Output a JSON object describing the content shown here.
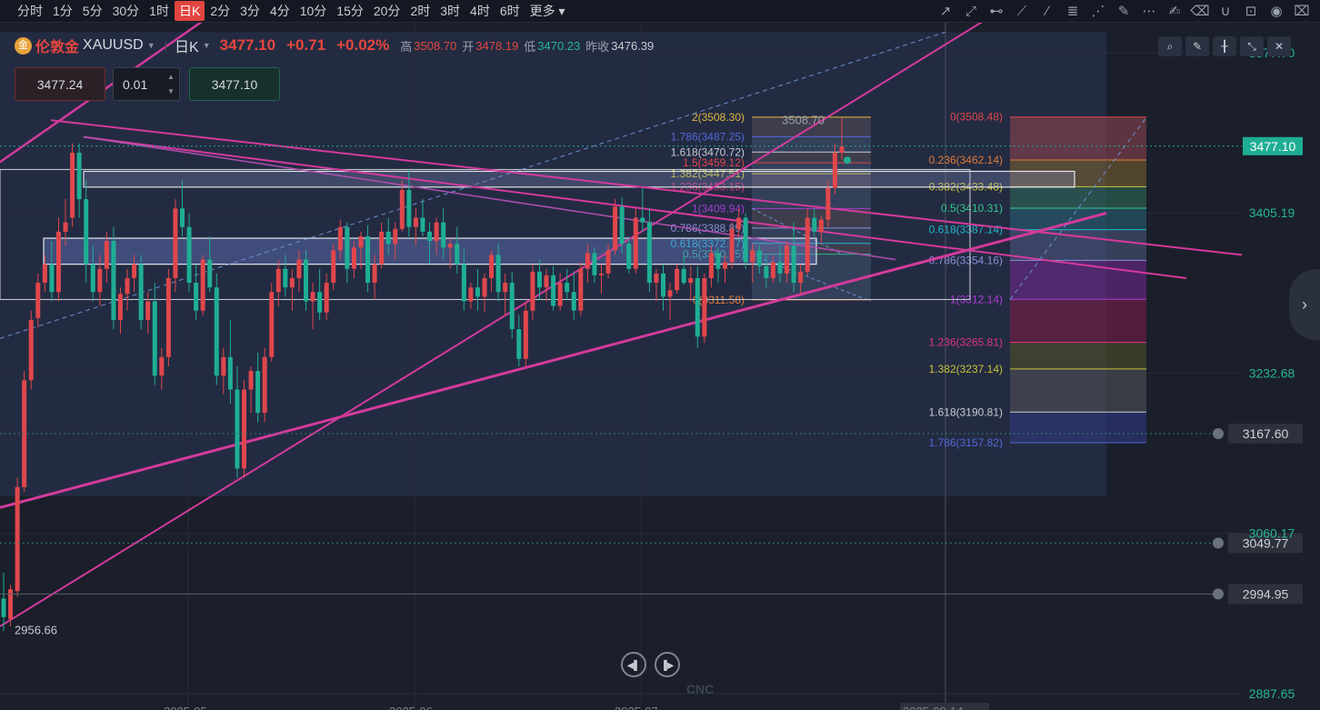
{
  "timeframes": [
    "分时",
    "1分",
    "5分",
    "30分",
    "1时",
    "日K",
    "2分",
    "3分",
    "4分",
    "10分",
    "15分",
    "20分",
    "2时",
    "3时",
    "4时",
    "6时",
    "更多"
  ],
  "active_timeframe": "日K",
  "toolbar_icons": [
    "trend-line-icon",
    "ray-icon",
    "horizontal-line-icon",
    "polyline-icon",
    "brush-icon",
    "fibonacci-icon",
    "fan-icon",
    "pen-icon",
    "more-dots-icon",
    "note-icon",
    "eraser-icon",
    "magnet-icon",
    "lock-icon",
    "eye-icon",
    "trash-icon"
  ],
  "symbol": {
    "icon_text": "金",
    "name": "伦敦金",
    "code": "XAUUSD",
    "period": "日K",
    "price": "3477.10",
    "change": "+0.71",
    "change_pct": "+0.02%",
    "high_label": "高",
    "high": "3508.70",
    "open_label": "开",
    "open": "3478.19",
    "low_label": "低",
    "low": "3470.23",
    "prev_label": "昨收",
    "prev": "3476.39"
  },
  "order": {
    "sell": "3477.24",
    "qty": "0.01",
    "buy": "3477.10"
  },
  "colors": {
    "up": "#e0474c",
    "down": "#1fae94",
    "accent": "#e0453f",
    "magenta": "#d43a9c"
  },
  "chart_data": {
    "type": "candlestick",
    "y_range": [
      2870,
      3610
    ],
    "y_ticks": [
      "3577.70",
      "3405.19",
      "3232.68",
      "3060.17",
      "2887.65"
    ],
    "current_price": "3477.10",
    "alerts": [
      "3167.60",
      "3049.77",
      "2994.95"
    ],
    "low_label": "2956.66",
    "high_label": "3508.70",
    "x_ticks": [
      "2025-05",
      "2025-06",
      "2025-07",
      "2025-08-14"
    ],
    "candles": [
      [
        2990,
        3018,
        2955,
        2970
      ],
      [
        2968,
        3005,
        2960,
        3000
      ],
      [
        2998,
        3120,
        2992,
        3110
      ],
      [
        3110,
        3235,
        3105,
        3225
      ],
      [
        3225,
        3300,
        3215,
        3290
      ],
      [
        3292,
        3340,
        3282,
        3330
      ],
      [
        3330,
        3360,
        3320,
        3350
      ],
      [
        3350,
        3375,
        3310,
        3320
      ],
      [
        3320,
        3400,
        3310,
        3385
      ],
      [
        3385,
        3420,
        3370,
        3395
      ],
      [
        3400,
        3480,
        3390,
        3470
      ],
      [
        3470,
        3480,
        3400,
        3420
      ],
      [
        3420,
        3440,
        3330,
        3350
      ],
      [
        3350,
        3370,
        3310,
        3320
      ],
      [
        3320,
        3360,
        3305,
        3345
      ],
      [
        3345,
        3385,
        3330,
        3375
      ],
      [
        3375,
        3390,
        3280,
        3290
      ],
      [
        3290,
        3325,
        3275,
        3318
      ],
      [
        3318,
        3345,
        3300,
        3335
      ],
      [
        3335,
        3360,
        3320,
        3350
      ],
      [
        3350,
        3360,
        3280,
        3290
      ],
      [
        3290,
        3320,
        3275,
        3310
      ],
      [
        3310,
        3330,
        3220,
        3230
      ],
      [
        3230,
        3260,
        3215,
        3250
      ],
      [
        3250,
        3345,
        3240,
        3335
      ],
      [
        3335,
        3420,
        3320,
        3410
      ],
      [
        3410,
        3440,
        3380,
        3390
      ],
      [
        3390,
        3405,
        3320,
        3330
      ],
      [
        3330,
        3350,
        3290,
        3300
      ],
      [
        3300,
        3360,
        3295,
        3355
      ],
      [
        3355,
        3380,
        3320,
        3325
      ],
      [
        3325,
        3340,
        3220,
        3230
      ],
      [
        3230,
        3260,
        3210,
        3250
      ],
      [
        3250,
        3290,
        3200,
        3215
      ],
      [
        3215,
        3240,
        3120,
        3130
      ],
      [
        3130,
        3225,
        3120,
        3215
      ],
      [
        3215,
        3240,
        3190,
        3235
      ],
      [
        3235,
        3255,
        3180,
        3190
      ],
      [
        3190,
        3260,
        3180,
        3250
      ],
      [
        3250,
        3330,
        3245,
        3320
      ],
      [
        3320,
        3355,
        3305,
        3345
      ],
      [
        3345,
        3360,
        3315,
        3325
      ],
      [
        3325,
        3345,
        3300,
        3335
      ],
      [
        3335,
        3365,
        3320,
        3355
      ],
      [
        3355,
        3365,
        3300,
        3310
      ],
      [
        3310,
        3330,
        3280,
        3320
      ],
      [
        3320,
        3345,
        3290,
        3298
      ],
      [
        3298,
        3340,
        3290,
        3330
      ],
      [
        3330,
        3372,
        3322,
        3365
      ],
      [
        3365,
        3398,
        3355,
        3390
      ],
      [
        3390,
        3395,
        3330,
        3345
      ],
      [
        3345,
        3375,
        3335,
        3368
      ],
      [
        3368,
        3385,
        3345,
        3380
      ],
      [
        3380,
        3392,
        3320,
        3330
      ],
      [
        3330,
        3360,
        3312,
        3350
      ],
      [
        3350,
        3395,
        3345,
        3385
      ],
      [
        3385,
        3400,
        3360,
        3372
      ],
      [
        3372,
        3395,
        3355,
        3388
      ],
      [
        3388,
        3440,
        3385,
        3430
      ],
      [
        3430,
        3452,
        3380,
        3390
      ],
      [
        3390,
        3410,
        3370,
        3400
      ],
      [
        3400,
        3420,
        3380,
        3385
      ],
      [
        3385,
        3395,
        3350,
        3375
      ],
      [
        3375,
        3400,
        3360,
        3395
      ],
      [
        3395,
        3410,
        3355,
        3368
      ],
      [
        3368,
        3378,
        3345,
        3372
      ],
      [
        3372,
        3390,
        3340,
        3350
      ],
      [
        3350,
        3366,
        3300,
        3310
      ],
      [
        3310,
        3330,
        3302,
        3325
      ],
      [
        3325,
        3345,
        3300,
        3315
      ],
      [
        3315,
        3340,
        3298,
        3335
      ],
      [
        3335,
        3365,
        3320,
        3360
      ],
      [
        3360,
        3372,
        3310,
        3320
      ],
      [
        3320,
        3340,
        3295,
        3330
      ],
      [
        3330,
        3342,
        3270,
        3280
      ],
      [
        3280,
        3295,
        3240,
        3248
      ],
      [
        3248,
        3310,
        3240,
        3300
      ],
      [
        3300,
        3350,
        3290,
        3342
      ],
      [
        3342,
        3355,
        3312,
        3325
      ],
      [
        3325,
        3345,
        3310,
        3338
      ],
      [
        3338,
        3348,
        3300,
        3305
      ],
      [
        3305,
        3340,
        3300,
        3330
      ],
      [
        3330,
        3345,
        3312,
        3320
      ],
      [
        3320,
        3342,
        3290,
        3300
      ],
      [
        3300,
        3352,
        3295,
        3345
      ],
      [
        3345,
        3372,
        3330,
        3362
      ],
      [
        3362,
        3368,
        3330,
        3338
      ],
      [
        3338,
        3350,
        3318,
        3340
      ],
      [
        3340,
        3372,
        3335,
        3365
      ],
      [
        3365,
        3420,
        3360,
        3412
      ],
      [
        3412,
        3422,
        3362,
        3372
      ],
      [
        3372,
        3380,
        3340,
        3345
      ],
      [
        3345,
        3410,
        3340,
        3400
      ],
      [
        3400,
        3432,
        3385,
        3395
      ],
      [
        3395,
        3410,
        3320,
        3330
      ],
      [
        3330,
        3345,
        3310,
        3340
      ],
      [
        3340,
        3350,
        3300,
        3315
      ],
      [
        3315,
        3330,
        3290,
        3322
      ],
      [
        3322,
        3350,
        3318,
        3345
      ],
      [
        3345,
        3360,
        3328,
        3330
      ],
      [
        3330,
        3348,
        3310,
        3335
      ],
      [
        3335,
        3348,
        3260,
        3272
      ],
      [
        3272,
        3340,
        3265,
        3335
      ],
      [
        3335,
        3370,
        3325,
        3362
      ],
      [
        3362,
        3368,
        3330,
        3345
      ],
      [
        3345,
        3360,
        3330,
        3352
      ],
      [
        3352,
        3395,
        3345,
        3388
      ],
      [
        3388,
        3410,
        3380,
        3400
      ],
      [
        3400,
        3405,
        3345,
        3352
      ],
      [
        3352,
        3372,
        3330,
        3365
      ],
      [
        3365,
        3370,
        3340,
        3348
      ],
      [
        3348,
        3360,
        3325,
        3335
      ],
      [
        3335,
        3360,
        3330,
        3352
      ],
      [
        3352,
        3370,
        3330,
        3340
      ],
      [
        3340,
        3375,
        3330,
        3370
      ],
      [
        3370,
        3395,
        3320,
        3330
      ],
      [
        3330,
        3350,
        3318,
        3342
      ],
      [
        3342,
        3410,
        3338,
        3400
      ],
      [
        3400,
        3410,
        3380,
        3385
      ],
      [
        3385,
        3402,
        3372,
        3398
      ],
      [
        3398,
        3440,
        3390,
        3432
      ],
      [
        3432,
        3480,
        3425,
        3470
      ],
      [
        3470,
        3508,
        3462,
        3477
      ]
    ]
  },
  "fib_left": {
    "levels": [
      {
        "label": "2(3508.30)",
        "price": 3508.3,
        "color": "#e2b93b"
      },
      {
        "label": "1.786(3487.25)",
        "price": 3487.25,
        "color": "#5467d8"
      },
      {
        "label": "1.618(3470.72)",
        "price": 3470.72,
        "color": "#c8cbd2"
      },
      {
        "label": "1.5(3459.12)",
        "price": 3459.12,
        "color": "#e0474c"
      },
      {
        "label": "1.382(3447.51)",
        "price": 3447.51,
        "color": "#c6c23a"
      },
      {
        "label": "1.236(3433.15)",
        "price": 3433.15,
        "color": "#c7357e"
      },
      {
        "label": "1(3409.94)",
        "price": 3409.94,
        "color": "#9f3fd2"
      },
      {
        "label": "0.786(3388.89)",
        "price": 3388.89,
        "color": "#8a8fd6"
      },
      {
        "label": "0.618(3372.37)",
        "price": 3372.37,
        "color": "#1fb8c9"
      },
      {
        "label": "0.5(3360.75)",
        "price": 3360.75,
        "color": "#2fae8d"
      },
      {
        "label": "0(3311.58)",
        "price": 3311.58,
        "color": "#e07b39"
      }
    ],
    "high_text": "3508.70"
  },
  "fib_right": {
    "levels": [
      {
        "label": "0(3508.48)",
        "price": 3508.48,
        "color": "#e0474c",
        "fill": "rgba(150,70,80,0.55)"
      },
      {
        "label": "0.236(3462.14)",
        "price": 3462.14,
        "color": "#e07b39",
        "fill": "rgba(130,100,50,0.55)"
      },
      {
        "label": "0.382(3433.48)",
        "price": 3433.48,
        "color": "#c6c23a",
        "fill": "rgba(50,110,90,0.55)"
      },
      {
        "label": "0.5(3410.31)",
        "price": 3410.31,
        "color": "#2fc98d",
        "fill": "rgba(40,100,120,0.55)"
      },
      {
        "label": "0.618(3387.14)",
        "price": 3387.14,
        "color": "#1fb8c9",
        "fill": "rgba(80,90,130,0.55)"
      },
      {
        "label": "0.786(3354.16)",
        "price": 3354.16,
        "color": "#8a8fd6",
        "fill": "rgba(110,40,140,0.6)"
      },
      {
        "label": "1(3312.14)",
        "price": 3312.14,
        "color": "#b03bd8",
        "fill": "rgba(120,30,70,0.6)"
      },
      {
        "label": "1.236(3265.81)",
        "price": 3265.81,
        "color": "#e0357e",
        "fill": "rgba(80,80,40,0.6)"
      },
      {
        "label": "1.382(3237.14)",
        "price": 3237.14,
        "color": "#c6c23a",
        "fill": "rgba(80,80,85,0.6)"
      },
      {
        "label": "1.618(3190.81)",
        "price": 3190.81,
        "color": "#c8cbd2",
        "fill": "rgba(45,55,120,0.65)"
      },
      {
        "label": "1.786(3157.82)",
        "price": 3157.82,
        "color": "#5467d8",
        "fill": null
      }
    ]
  },
  "nav": {
    "prev_icon": "step-back-icon",
    "next_icon": "step-forward-icon"
  },
  "watermark": "CNC",
  "right_tools": [
    "indicator-edit-icon",
    "pencil-icon",
    "candle-type-icon",
    "expand-icon",
    "close-icon"
  ]
}
